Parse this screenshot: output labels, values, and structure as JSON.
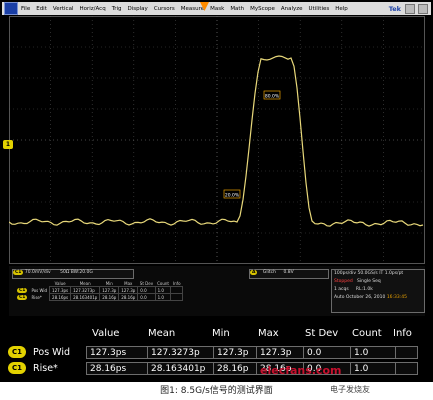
{
  "menu": [
    "File",
    "Edit",
    "Vertical",
    "Horiz/Acq",
    "Trig",
    "Display",
    "Cursors",
    "Measure",
    "Mask",
    "Math",
    "MyScope",
    "Analyze",
    "Utilities",
    "Help"
  ],
  "brand": "Tek",
  "markers": {
    "level_high": "80.0%",
    "level_low": "20.0%",
    "ch_marker": "1"
  },
  "channel_box": {
    "label": "C1",
    "scale": "70.0mV/div",
    "coupling": "50Ω",
    "bw": "BW:20.0G"
  },
  "trigger_box": {
    "label": "A",
    "mode": "Glitch",
    "level": "0.8V"
  },
  "timebase": {
    "scale": "100ps/div",
    "rate": "50.0GS/s",
    "interp": "IT",
    "res": "1.0ps/pt",
    "status": "Stopped",
    "seq": "Single Seq",
    "acqs": "1 acqs",
    "rl": "RL:1.0k",
    "auto": "Auto",
    "date": "October 26, 2010",
    "time": "16:33:45"
  },
  "small_headers": [
    "Value",
    "Mean",
    "Min",
    "Max",
    "St Dev",
    "Count",
    "Info"
  ],
  "headers": [
    "Value",
    "Mean",
    "Min",
    "Max",
    "St Dev",
    "Count",
    "Info"
  ],
  "rows": [
    {
      "tag": "C1",
      "name": "Pos Wid",
      "value": "127.3ps",
      "mean": "127.3273p",
      "min": "127.3p",
      "max": "127.3p",
      "stdev": "0.0",
      "count": "1.0",
      "info": ""
    },
    {
      "tag": "C1",
      "name": "Rise*",
      "value": "28.16ps",
      "mean": "28.163401p",
      "min": "28.16p",
      "max": "28.16p",
      "stdev": "0.0",
      "count": "1.0",
      "info": ""
    }
  ],
  "small_rows": [
    {
      "tag": "C1",
      "name": "Pos Wid",
      "value": "127.3ps",
      "mean": "127.3273p",
      "min": "127.3p",
      "max": "127.3p",
      "stdev": "0.0",
      "count": "1.0"
    },
    {
      "tag": "C1",
      "name": "Rise*",
      "value": "28.16ps",
      "mean": "28.163401p",
      "min": "28.16p",
      "max": "28.16p",
      "stdev": "0.0",
      "count": "1.0"
    }
  ],
  "caption": "图1: 8.5G/s信号的测试界面",
  "watermark": "elecfans.com",
  "watermark2": "电子发烧友",
  "colors": {
    "trace": "#e8d87a",
    "pill": "#e3d200",
    "background": "#000000"
  }
}
